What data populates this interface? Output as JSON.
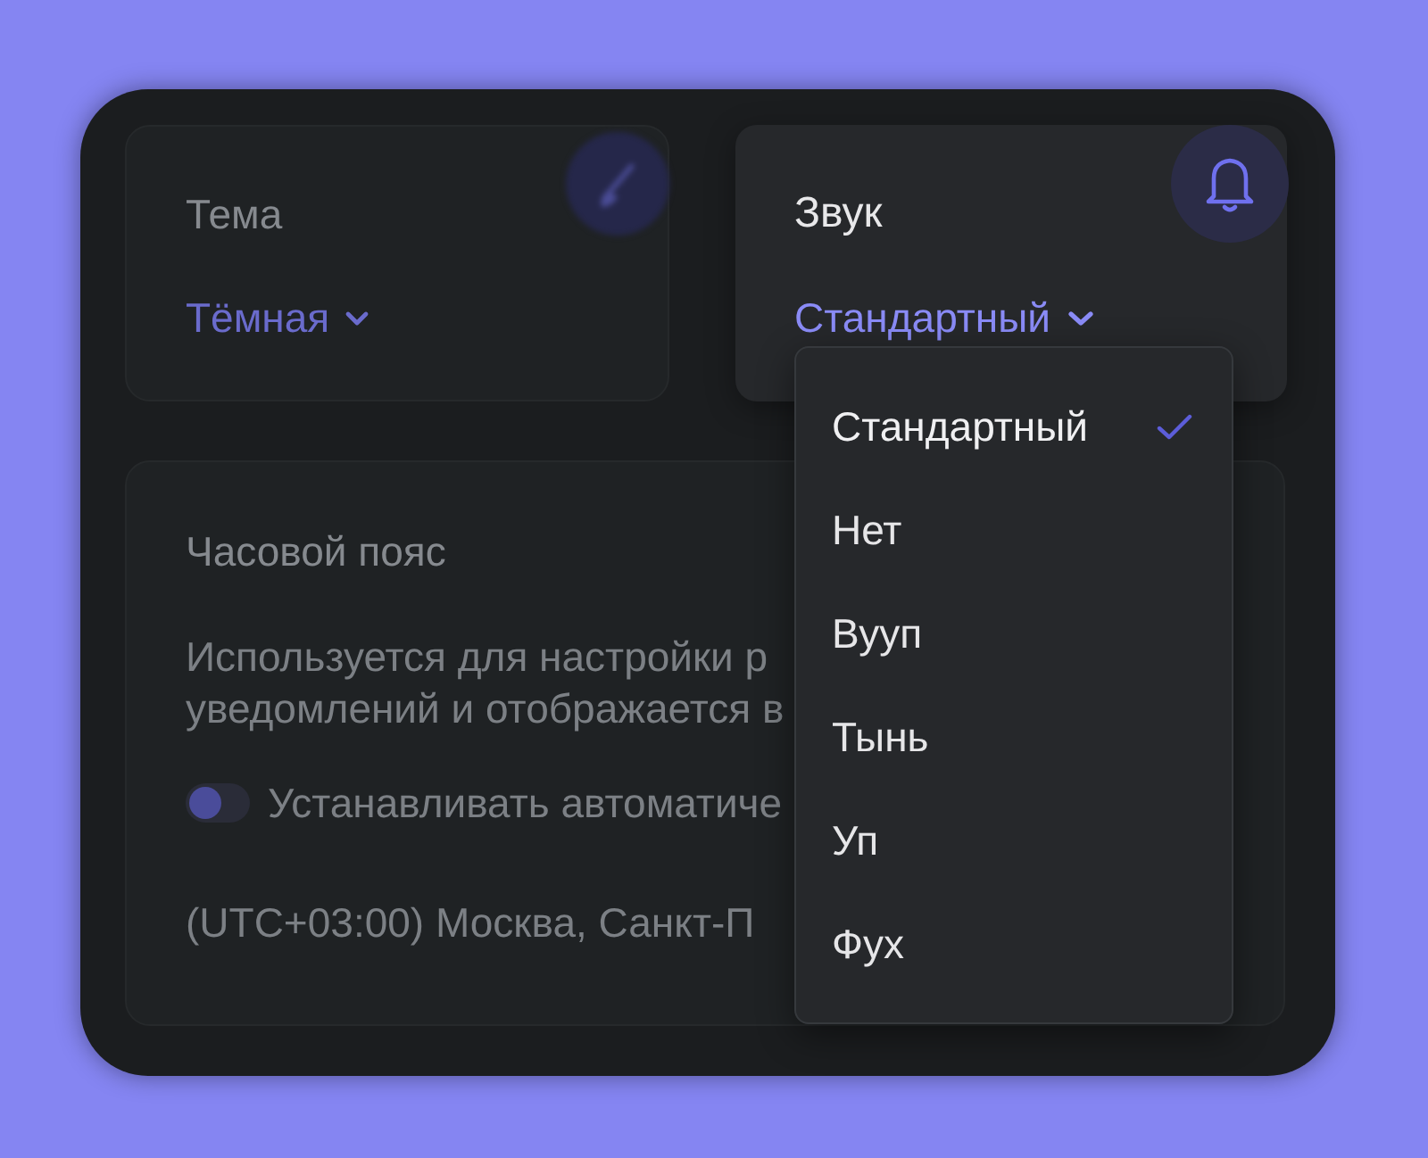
{
  "theme_card": {
    "title": "Тема",
    "value": "Тёмная"
  },
  "sound_card": {
    "title": "Звук",
    "value": "Стандартный",
    "expanded": true,
    "options": [
      {
        "label": "Стандартный",
        "selected": true
      },
      {
        "label": "Нет",
        "selected": false
      },
      {
        "label": "Вууп",
        "selected": false
      },
      {
        "label": "Тынь",
        "selected": false
      },
      {
        "label": "Уп",
        "selected": false
      },
      {
        "label": "Фух",
        "selected": false
      }
    ]
  },
  "timezone_card": {
    "title": "Часовой пояс",
    "description_lines": [
      "Используется для настройки р",
      "уведомлений и отображается в"
    ],
    "auto_toggle": {
      "label": "Устанавливать автоматиче",
      "on": false
    },
    "timezone": "(UTC+03:00) Москва, Санкт-П"
  }
}
